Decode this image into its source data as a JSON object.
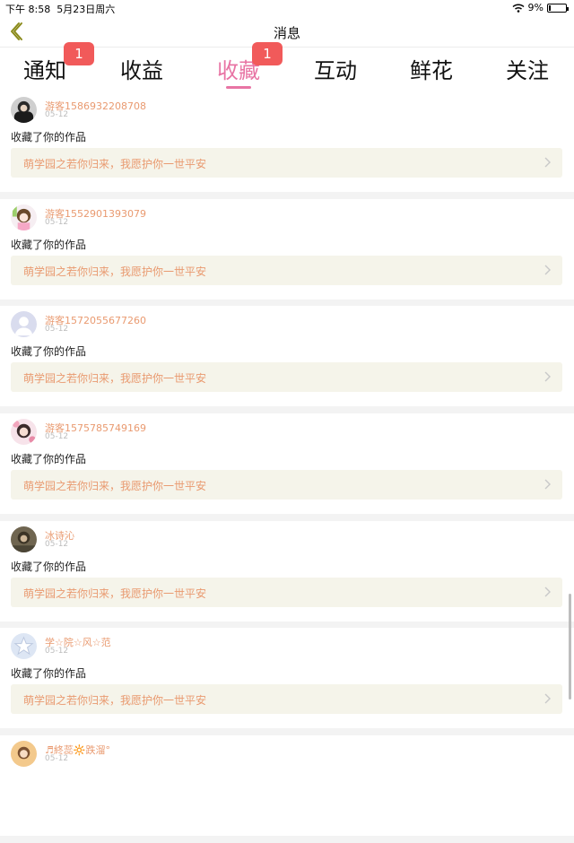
{
  "status_bar": {
    "time": "下午 8:58",
    "date": "5月23日周六",
    "battery": "9%",
    "battery_level": 0.09
  },
  "header": {
    "title": "消息"
  },
  "tabs": [
    {
      "label": "通知",
      "badge": "1"
    },
    {
      "label": "收益"
    },
    {
      "label": "收藏",
      "active": true,
      "badge": "1"
    },
    {
      "label": "互动"
    },
    {
      "label": "鲜花"
    },
    {
      "label": "关注"
    }
  ],
  "messages": [
    {
      "user": "游客1586932208708",
      "date": "05-12",
      "action": "收藏了你的作品",
      "work": "萌学园之若你归来，我愿护你一世平安",
      "avatar": "dark"
    },
    {
      "user": "游客1552901393079",
      "date": "05-12",
      "action": "收藏了你的作品",
      "work": "萌学园之若你归来，我愿护你一世平安",
      "avatar": "anime"
    },
    {
      "user": "游客1572055677260",
      "date": "05-12",
      "action": "收藏了你的作品",
      "work": "萌学园之若你归来，我愿护你一世平安",
      "avatar": "default"
    },
    {
      "user": "游客1575785749169",
      "date": "05-12",
      "action": "收藏了你的作品",
      "work": "萌学园之若你归来，我愿护你一世平安",
      "avatar": "girl"
    },
    {
      "user": "冰诗沁",
      "date": "05-12",
      "action": "收藏了你的作品",
      "work": "萌学园之若你归来，我愿护你一世平安",
      "avatar": "photo"
    },
    {
      "user": "学☆院☆风☆范",
      "date": "05-12",
      "action": "收藏了你的作品",
      "work": "萌学园之若你归来，我愿护你一世平安",
      "avatar": "star"
    },
    {
      "user": "♬終蕊🔆跌溜°",
      "date": "05-12",
      "action": "",
      "work": "",
      "avatar": "warm"
    }
  ],
  "colors": {
    "accent": "#e874a4",
    "username": "#e99a70",
    "badge": "#f15a5a",
    "link_bg": "#f5f4ea"
  }
}
